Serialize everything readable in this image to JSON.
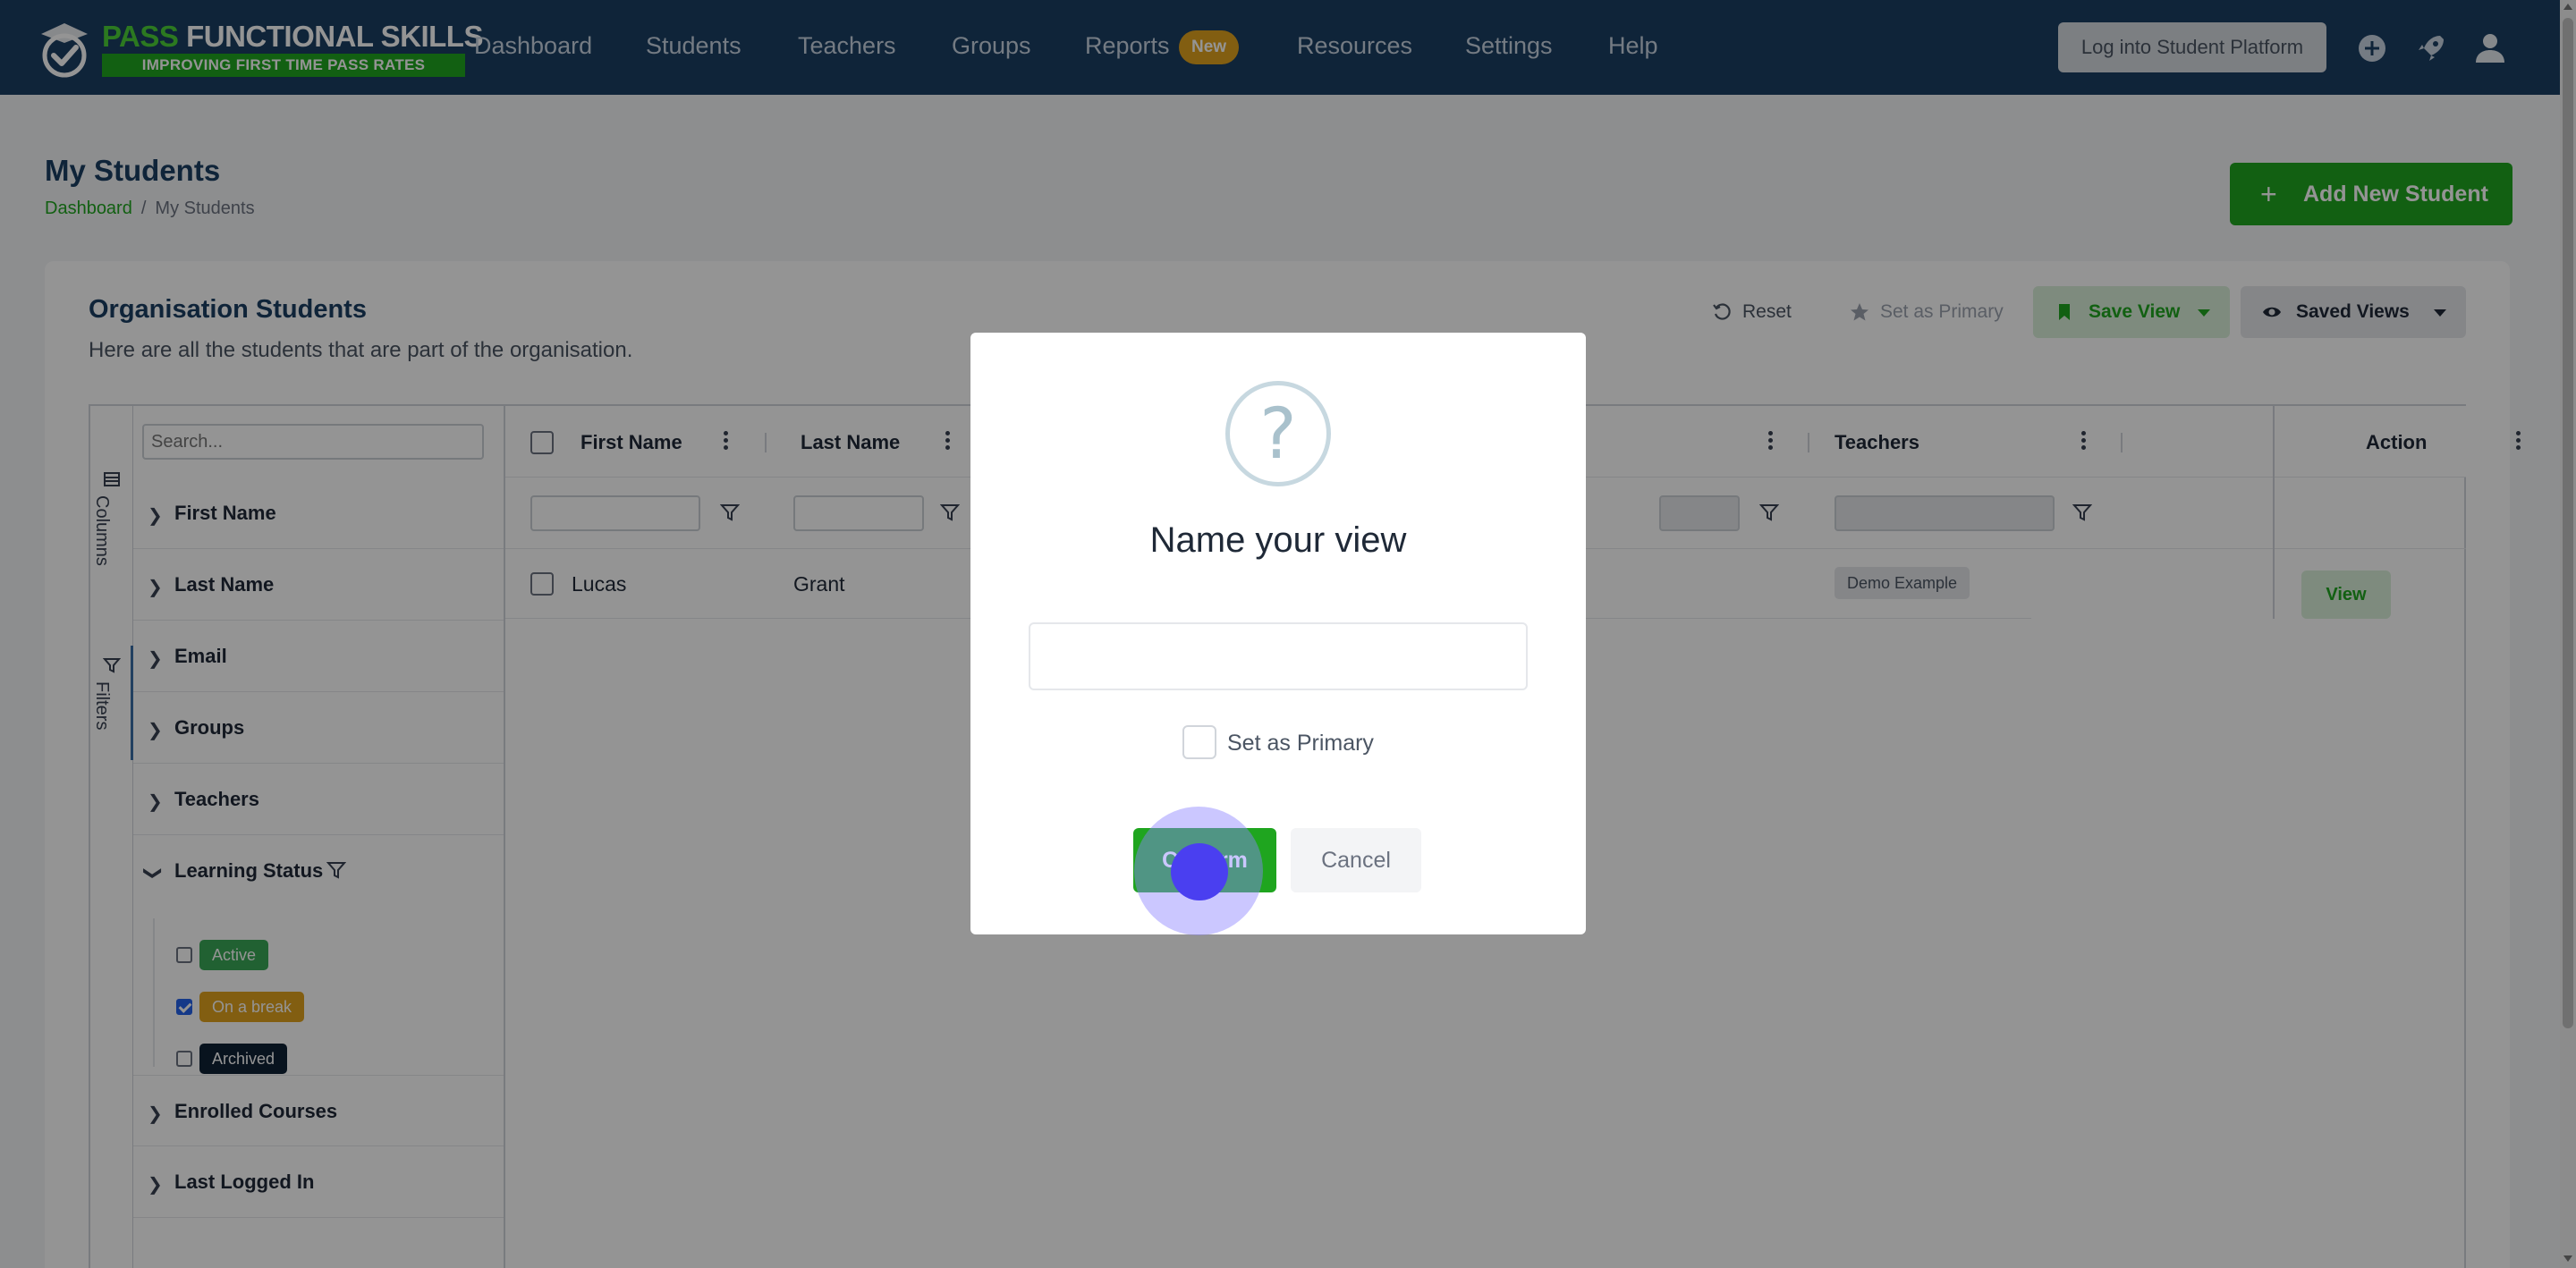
{
  "brand": {
    "title_accent": "PASS",
    "title_rest": " FUNCTIONAL SKILLS",
    "tagline": "IMPROVING FIRST TIME PASS RATES"
  },
  "nav": {
    "items": [
      "Dashboard",
      "Students",
      "Teachers",
      "Groups",
      "Reports",
      "Resources",
      "Settings",
      "Help"
    ],
    "reports_badge": "New",
    "login_button": "Log into Student Platform"
  },
  "page": {
    "title": "My Students",
    "breadcrumb_home": "Dashboard",
    "breadcrumb_sep": "/",
    "breadcrumb_current": "My Students",
    "add_button": "Add New Student",
    "add_button_icon": "+"
  },
  "card": {
    "title": "Organisation Students",
    "subtitle": "Here are all the students that are part of the organisation.",
    "toolbar": {
      "reset": "Reset",
      "set_primary": "Set as Primary",
      "save_view": "Save View",
      "saved_views": "Saved Views"
    }
  },
  "grid": {
    "side_tabs": [
      "Columns",
      "Filters"
    ],
    "search_placeholder": "Search...",
    "filters": [
      "First Name",
      "Last Name",
      "Email",
      "Groups",
      "Teachers",
      "Learning Status",
      "Enrolled Courses",
      "Last Logged In"
    ],
    "learning_status_options": [
      {
        "label": "Active",
        "checked": false,
        "color": "#3aa757"
      },
      {
        "label": "On a break",
        "checked": true,
        "color": "#e0a21e"
      },
      {
        "label": "Archived",
        "checked": false,
        "color": "#0f2235"
      }
    ],
    "columns": [
      "First Name",
      "Last Name",
      "Teachers",
      "Action"
    ],
    "rows": [
      {
        "first_name": "Lucas",
        "last_name": "Grant",
        "teacher": "Demo Example",
        "action": "View"
      }
    ]
  },
  "modal": {
    "icon": "?",
    "title": "Name your view",
    "input_value": "",
    "checkbox_label": "Set as Primary",
    "confirm": "Confirm",
    "cancel": "Cancel"
  },
  "colors": {
    "nav_bg": "#1b3e63",
    "brand_green": "#1fa51f",
    "accent_badge": "#e0a21e"
  }
}
